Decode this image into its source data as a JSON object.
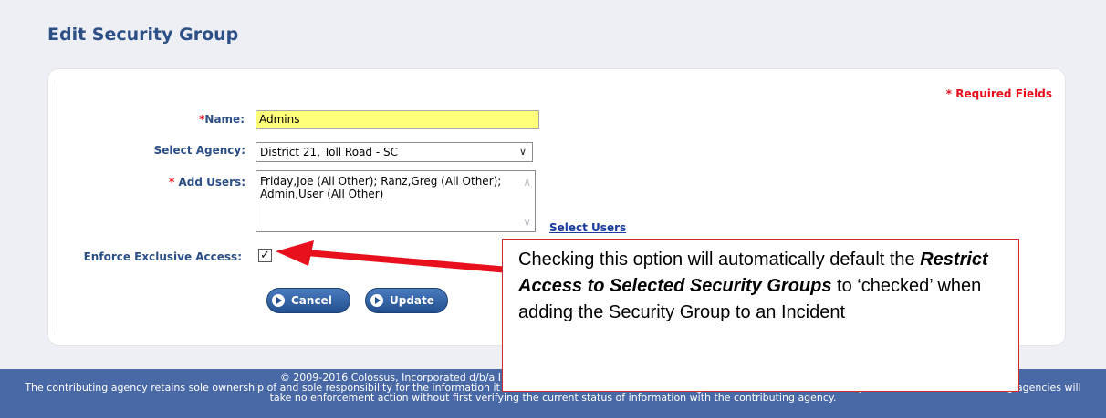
{
  "page_title": "Edit Security Group",
  "required_note": "* Required Fields",
  "form": {
    "name_label": "Name:",
    "name_value": "Admins",
    "agency_label": "Select Agency:",
    "agency_value": "District 21, Toll Road - SC",
    "users_label": "Add Users:",
    "users_value": "Friday,Joe (All Other); Ranz,Greg (All Other); Admin,User (All Other)",
    "select_users_link": "Select Users",
    "exclusive_label": "Enforce Exclusive Access:",
    "exclusive_checked": true
  },
  "buttons": {
    "cancel": "Cancel",
    "update": "Update"
  },
  "callout": {
    "text_1": "Checking this option will automatically default the ",
    "text_bold": "Restrict Access to Selected Security Groups",
    "text_2": " to ‘checked’ when adding the Security Group to an Incident"
  },
  "footer": {
    "line_1": "© 2009-2016 Colossus, Incorporated d/b/a InterAct Public Safety Systems. -- For Official Use Only / Sensitive",
    "line_2": "The contributing agency retains sole ownership of and sole responsibility for the information it contributes to the Online RMS including but not limited to, the accuracy of the information. Receiving agencies will",
    "line_3": "take no enforcement action without first verifying the current status of information with the contributing agency."
  },
  "colors": {
    "title": "#2c4f86",
    "required": "#e8101c",
    "button": "#23508f",
    "footer_bg": "#4868a6",
    "callout_border": "#d12a2a",
    "arrow": "#e8101c"
  }
}
